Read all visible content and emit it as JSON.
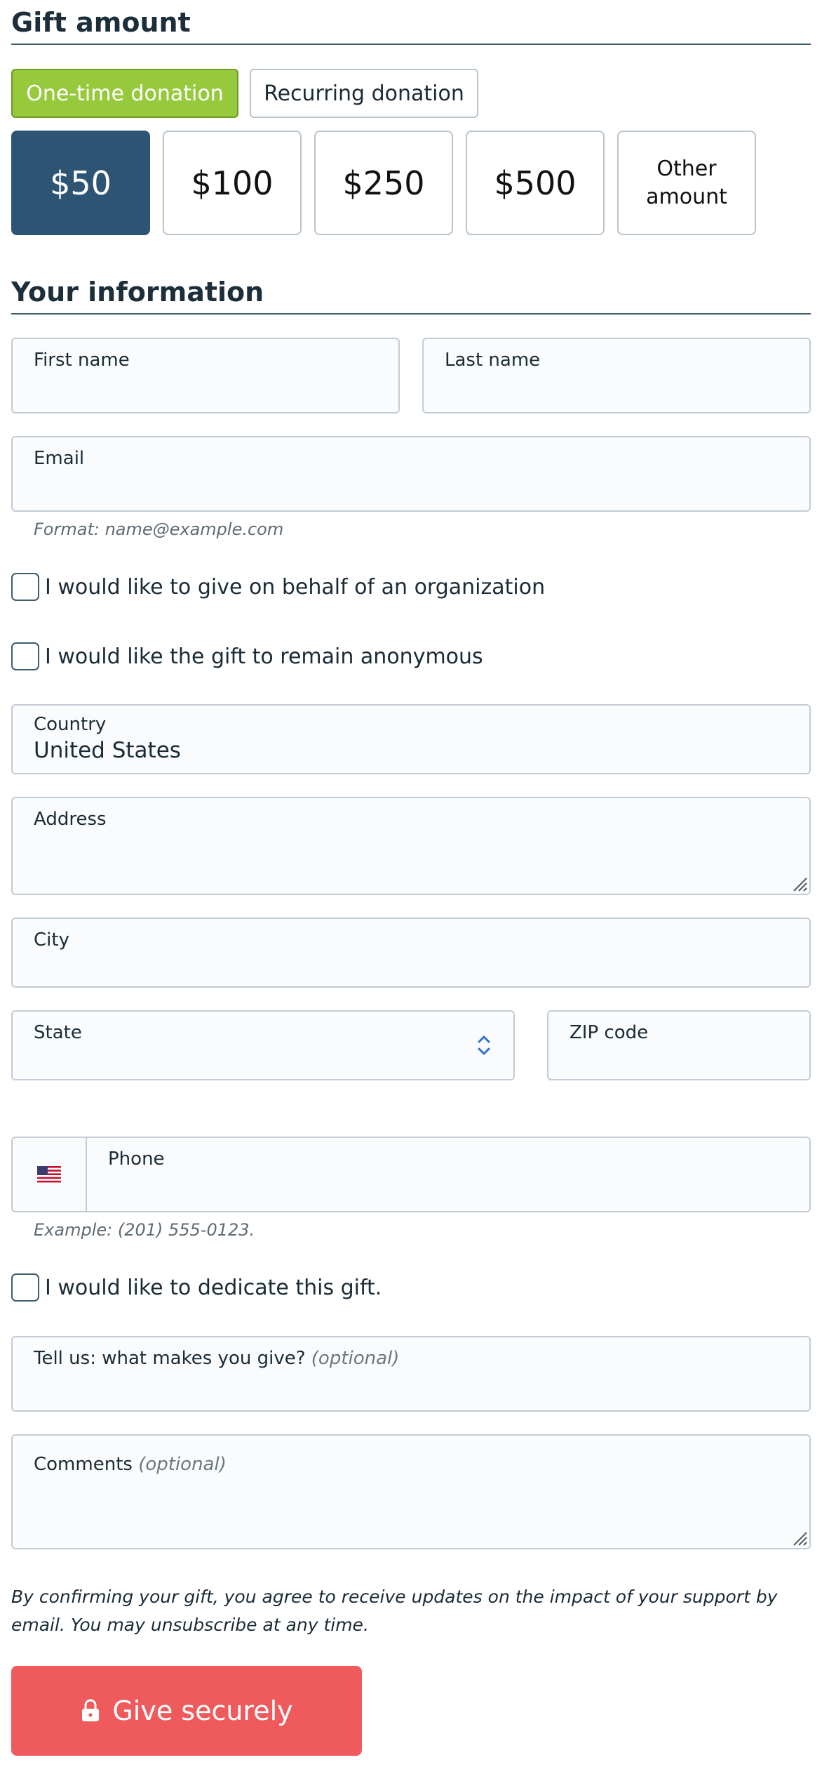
{
  "gift_section": {
    "title": "Gift amount",
    "frequency": {
      "one_time": "One-time donation",
      "recurring": "Recurring donation",
      "selected": "one_time"
    },
    "amounts": [
      {
        "label": "$50",
        "selected": true
      },
      {
        "label": "$100",
        "selected": false
      },
      {
        "label": "$250",
        "selected": false
      },
      {
        "label": "$500",
        "selected": false
      }
    ],
    "other_amount_line1": "Other",
    "other_amount_line2": "amount"
  },
  "info_section": {
    "title": "Your information",
    "first_name_label": "First name",
    "first_name_value": "",
    "last_name_label": "Last name",
    "last_name_value": "",
    "email_label": "Email",
    "email_value": "",
    "email_hint": "Format: name@example.com",
    "organization_checkbox": "I would like to give on behalf of an organization",
    "anonymous_checkbox": "I would like the gift to remain anonymous",
    "country_label": "Country",
    "country_value": "United States",
    "address_label": "Address",
    "address_value": "",
    "city_label": "City",
    "city_value": "",
    "state_label": "State",
    "state_value": "",
    "zip_label": "ZIP code",
    "zip_value": "",
    "phone_label": "Phone",
    "phone_value": "",
    "phone_hint": "Example: (201) 555-0123.",
    "dedicate_checkbox": "I would like to dedicate this gift.",
    "motivation_label": "Tell us: what makes you give?",
    "motivation_optional": "(optional)",
    "comments_label": "Comments",
    "comments_optional": "(optional)"
  },
  "footer": {
    "disclaimer": "By confirming your gift, you agree to receive updates on the impact of your support by email. You may unsubscribe at any time.",
    "submit_label": "Give securely"
  },
  "icons": {
    "flag": "us-flag-icon",
    "lock": "lock-icon",
    "select": "select-arrows-icon",
    "resize": "resize-grip-icon"
  },
  "colors": {
    "primary_selected": "#2e5474",
    "frequency_active": "#97c93d",
    "submit": "#ef5a5c",
    "text": "#1a2b36"
  }
}
